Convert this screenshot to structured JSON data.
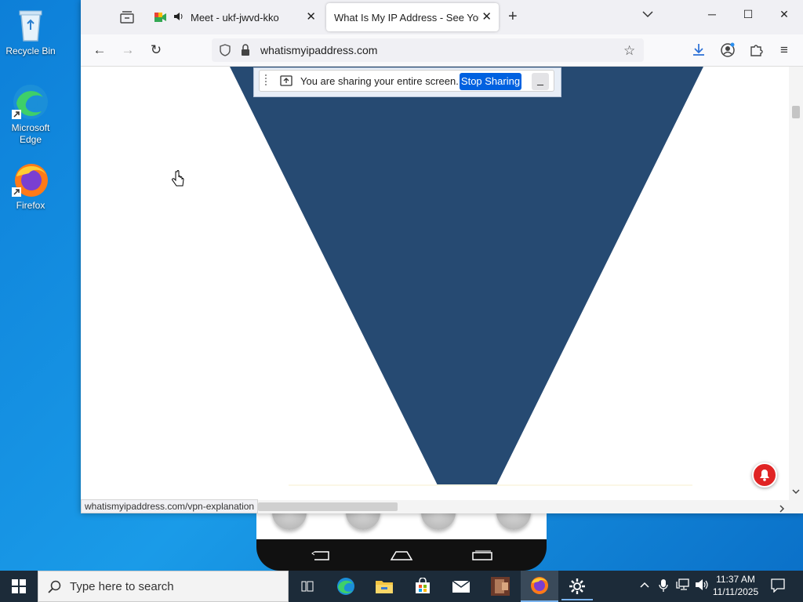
{
  "desktop": {
    "icons": [
      {
        "label": "Recycle Bin"
      },
      {
        "label": "Microsoft Edge"
      },
      {
        "label": "Firefox"
      }
    ]
  },
  "browser": {
    "tabs": [
      {
        "title": "Meet - ukf-jwvd-kko",
        "active": false
      },
      {
        "title": "What Is My IP Address - See Your Public IP",
        "active": true
      }
    ],
    "url": "whatismyipaddress.com",
    "status_url": "whatismyipaddress.com/vpn-explanation",
    "page_graphic_color": "#264a72"
  },
  "sharing": {
    "message": "You are sharing your entire screen.",
    "stop_label": "Stop Sharing"
  },
  "taskbar": {
    "search_placeholder": "Type here to search",
    "time": "11:37 AM",
    "date": "11/11/2025"
  },
  "colors": {
    "desktop": "#1a8de0",
    "stop_button": "#0061e0",
    "notification_badge": "#e02424"
  }
}
